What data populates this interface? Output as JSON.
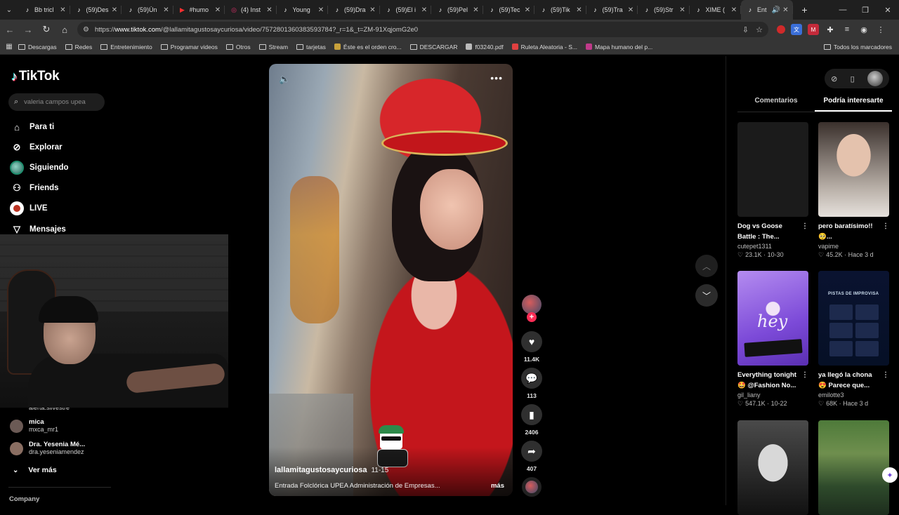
{
  "browser": {
    "tabs": [
      {
        "title": "Bb tricl",
        "icon": "tiktok-icon"
      },
      {
        "title": "(59)Des",
        "icon": "tiktok-icon"
      },
      {
        "title": "(59)Ún",
        "icon": "tiktok-icon"
      },
      {
        "title": "#humo",
        "icon": "youtube-icon"
      },
      {
        "title": "(4) Inst",
        "icon": "instagram-icon"
      },
      {
        "title": "Young",
        "icon": "tiktok-icon"
      },
      {
        "title": "(59)Dra",
        "icon": "tiktok-icon"
      },
      {
        "title": "(59)El i",
        "icon": "tiktok-icon"
      },
      {
        "title": "(59)Pel",
        "icon": "tiktok-icon"
      },
      {
        "title": "(59)Tec",
        "icon": "tiktok-icon"
      },
      {
        "title": "(59)Tik",
        "icon": "tiktok-icon"
      },
      {
        "title": "(59)Tra",
        "icon": "tiktok-icon"
      },
      {
        "title": "(59)Str",
        "icon": "tiktok-icon"
      },
      {
        "title": "XIME (",
        "icon": "tiktok-icon"
      },
      {
        "title": "Ent",
        "icon": "tiktok-icon",
        "active": true
      }
    ],
    "url_prefix": "https://",
    "url_host": "www.tiktok.com",
    "url_path": "/@lallamitagustosaycuriosa/video/7572801360383593784?_r=1&_t=ZM-91XqjomG2e0",
    "bookmarks": [
      {
        "label": "Descargas",
        "kind": "folder"
      },
      {
        "label": "Redes",
        "kind": "folder"
      },
      {
        "label": "Entretenimiento",
        "kind": "folder"
      },
      {
        "label": "Programar videos",
        "kind": "folder"
      },
      {
        "label": "Otros",
        "kind": "folder"
      },
      {
        "label": "Stream",
        "kind": "folder"
      },
      {
        "label": "tarjetas",
        "kind": "folder"
      },
      {
        "label": "Éste es el orden cro...",
        "kind": "page",
        "color": "#c8a13b"
      },
      {
        "label": "DESCARGAR",
        "kind": "folder"
      },
      {
        "label": "f03240.pdf",
        "kind": "page",
        "color": "#bbbbbb"
      },
      {
        "label": "Ruleta Aleatoria - S...",
        "kind": "page",
        "color": "#e04040"
      },
      {
        "label": "Mapa humano del p...",
        "kind": "page",
        "color": "#c03a8a"
      }
    ],
    "all_bookmarks": "Todos los marcadores"
  },
  "sidebar": {
    "logo": "TikTok",
    "search_placeholder": "valeria campos upea",
    "nav": [
      {
        "label": "Para ti",
        "icon": "home-icon"
      },
      {
        "label": "Explorar",
        "icon": "compass-icon"
      },
      {
        "label": "Siguiendo",
        "icon": "following-avatar-icon"
      },
      {
        "label": "Friends",
        "icon": "friends-icon"
      },
      {
        "label": "LIVE",
        "icon": "live-icon"
      },
      {
        "label": "Mensajes",
        "icon": "messages-icon"
      }
    ],
    "cut_user": "alerta.silvestre",
    "following": [
      {
        "name": "mica",
        "user": "mxca_mr1"
      },
      {
        "name": "Dra. Yesenia Mé...",
        "user": "dra.yeseniamendez"
      }
    ],
    "see_more": "Ver más",
    "company": "Company"
  },
  "video": {
    "author": "lallamitagustosaycuriosa",
    "date": "11-15",
    "caption": "Entrada Folclórica UPEA Administración de Empresas...",
    "more": "más",
    "likes": "11.4K",
    "comments": "113",
    "saves": "2406",
    "shares": "407"
  },
  "panel": {
    "tabs": [
      "Comentarios",
      "Podría interesarte"
    ],
    "active_tab": 1,
    "recommendations": [
      {
        "title": "Dog vs Goose Battle : The...",
        "user": "cutepet1311",
        "likes": "23.1K",
        "age": "10-30"
      },
      {
        "title": "pero baratísimo!! 🥺...",
        "user": "vapime",
        "likes": "45.2K",
        "age": "Hace 3 d"
      },
      {
        "title": "Everything tonight 🤩 @Fashion No...",
        "user": "gil_liany",
        "likes": "547.1K",
        "age": "10-22"
      },
      {
        "title": "ya llegó la chona 😍 Parece que...",
        "user": "emilotte3",
        "likes": "68K",
        "age": "Hace 3 d"
      },
      {
        "title": "",
        "user": "",
        "likes": "",
        "age": ""
      },
      {
        "title": "",
        "user": "",
        "likes": "",
        "age": ""
      }
    ],
    "thumb_text": {
      "hey": "hey",
      "pistas": "PISTAS DE IMPROVISA"
    }
  }
}
